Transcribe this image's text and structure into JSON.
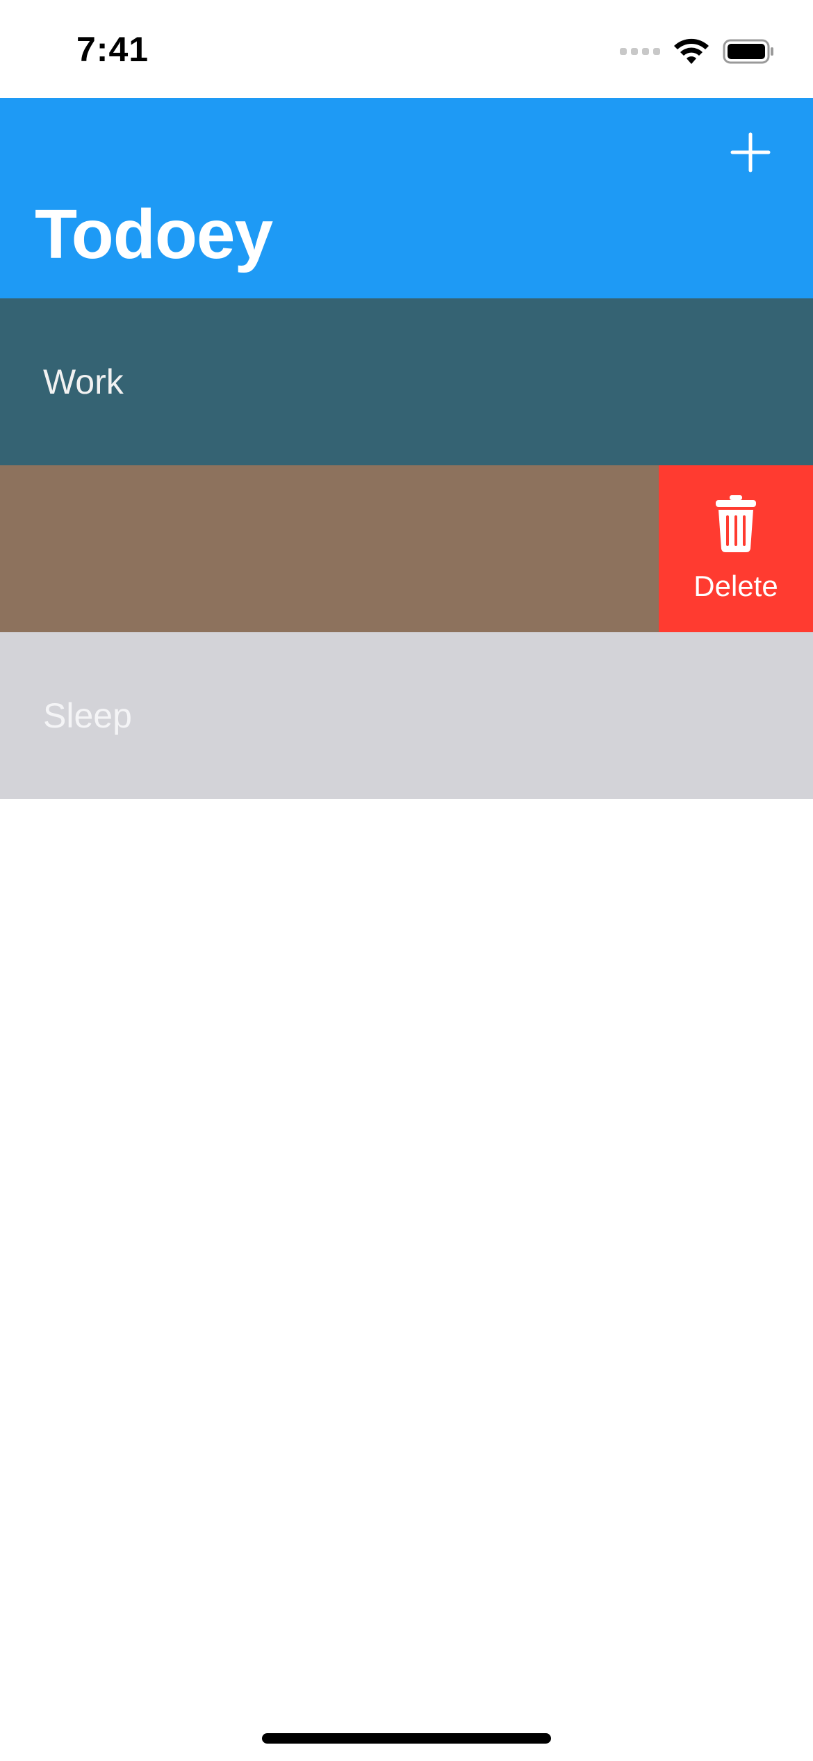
{
  "status_bar": {
    "time": "7:41",
    "icons": [
      "signal-icon",
      "wifi-icon",
      "battery-icon"
    ]
  },
  "nav": {
    "title": "Todoey",
    "add_icon": "plus-icon",
    "background_color": "#1e9af5"
  },
  "categories": [
    {
      "label": "Work",
      "background_color": "#356373",
      "text_color": "#f2f2f2",
      "swiped": false
    },
    {
      "label": "",
      "background_color": "#8d725d",
      "text_color": "#ffffff",
      "swiped": true
    },
    {
      "label": "Sleep",
      "background_color": "#d3d3d8",
      "text_color": "#f4f4f6",
      "swiped": false
    }
  ],
  "swipe_action": {
    "label": "Delete",
    "icon": "trash-icon",
    "background_color": "#ff3b30"
  }
}
